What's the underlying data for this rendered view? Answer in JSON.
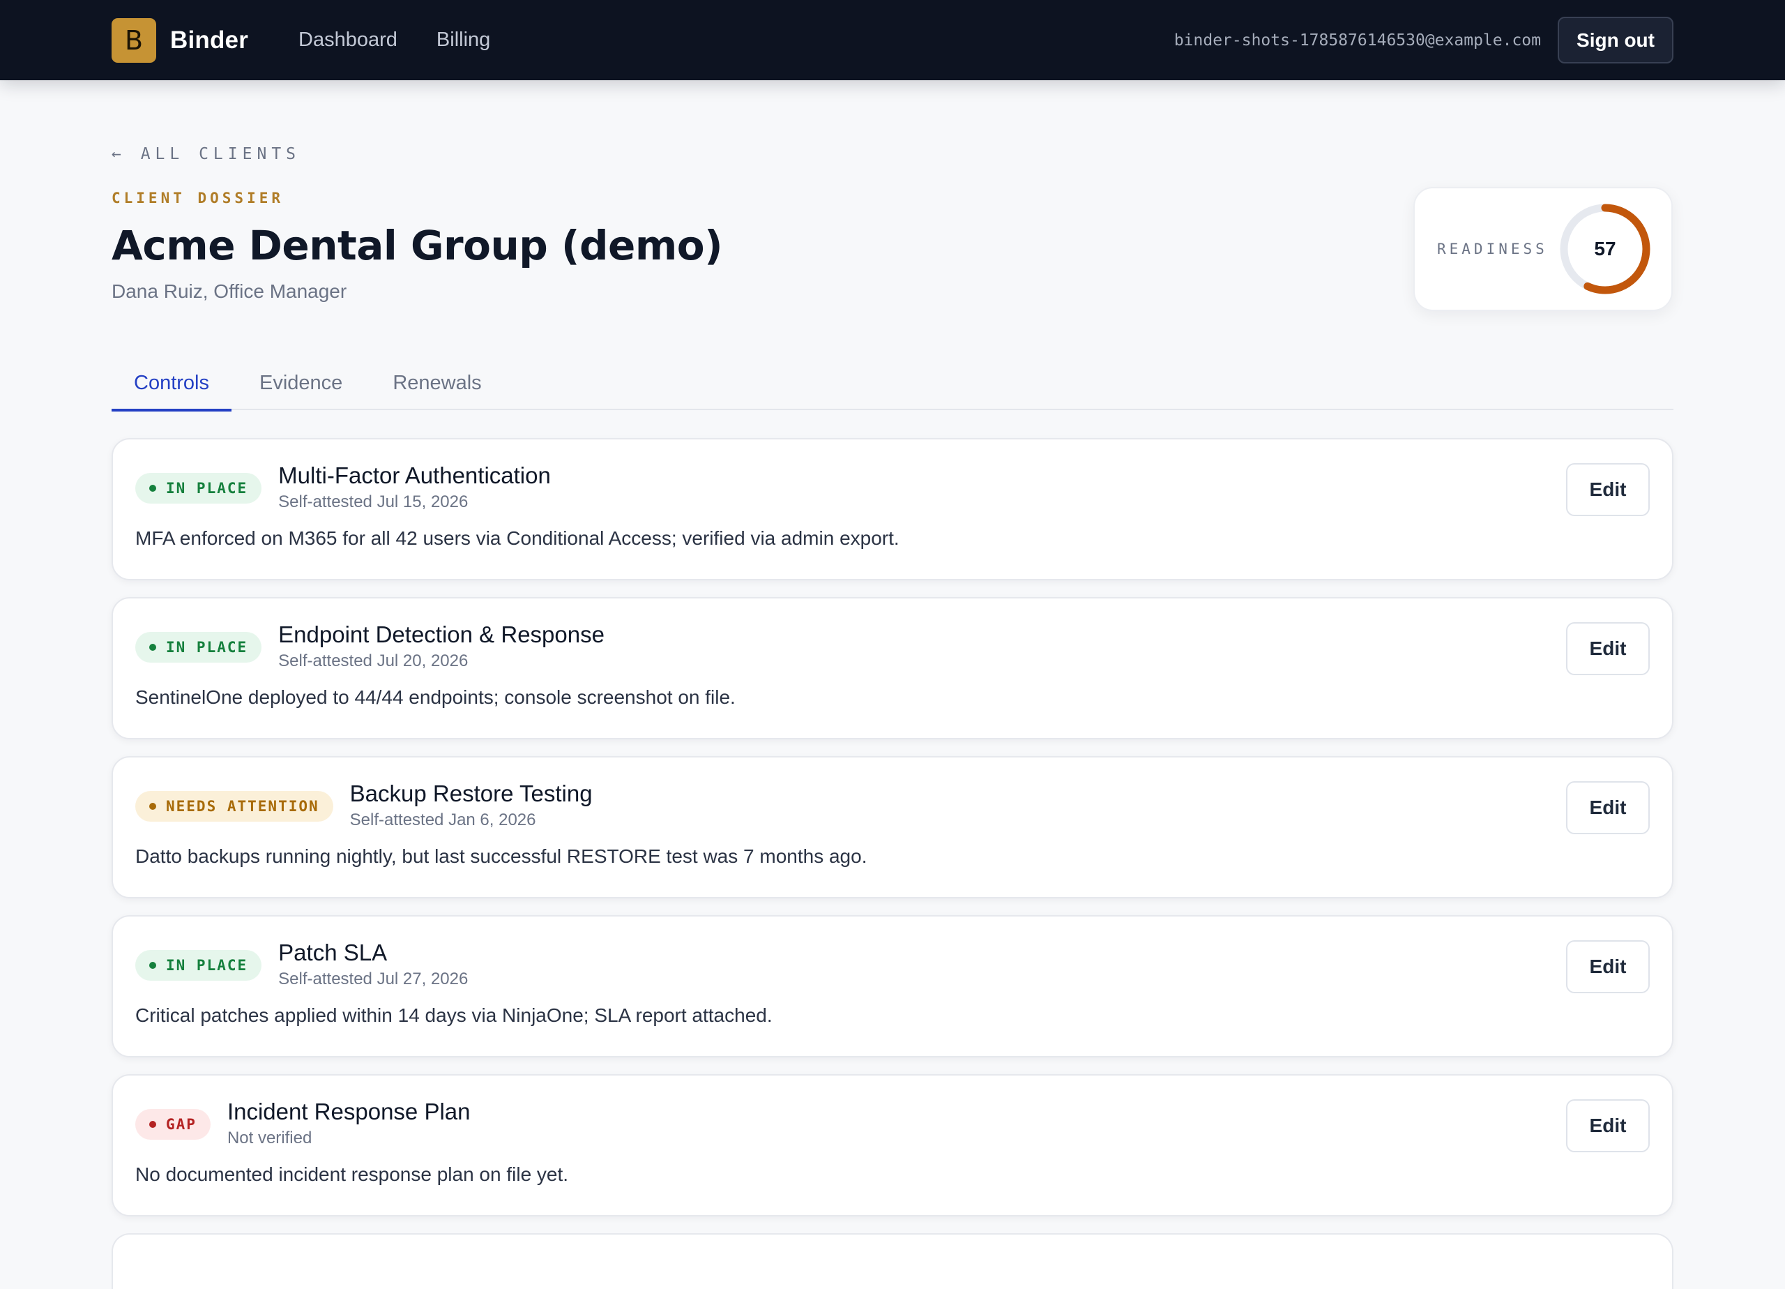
{
  "app": {
    "brand_initial": "B",
    "brand_name": "Binder",
    "nav": [
      "Dashboard",
      "Billing"
    ],
    "user_email": "binder-shots-1785876146530@example.com",
    "sign_out_label": "Sign out"
  },
  "header": {
    "back_label": "← ALL CLIENTS",
    "eyebrow": "CLIENT DOSSIER",
    "title": "Acme Dental Group (demo)",
    "subtitle": "Dana Ruiz, Office Manager",
    "readiness_label": "READINESS",
    "readiness_value": 57,
    "readiness_color": "#c2570c"
  },
  "tabs": [
    {
      "label": "Controls",
      "active": true
    },
    {
      "label": "Evidence",
      "active": false
    },
    {
      "label": "Renewals",
      "active": false
    }
  ],
  "controls": [
    {
      "status": "IN PLACE",
      "status_kind": "in-place",
      "title": "Multi-Factor Authentication",
      "attestation": "Self-attested Jul 15, 2026",
      "description": "MFA enforced on M365 for all 42 users via Conditional Access; verified via admin export.",
      "edit_label": "Edit"
    },
    {
      "status": "IN PLACE",
      "status_kind": "in-place",
      "title": "Endpoint Detection & Response",
      "attestation": "Self-attested Jul 20, 2026",
      "description": "SentinelOne deployed to 44/44 endpoints; console screenshot on file.",
      "edit_label": "Edit"
    },
    {
      "status": "NEEDS ATTENTION",
      "status_kind": "attention",
      "title": "Backup Restore Testing",
      "attestation": "Self-attested Jan 6, 2026",
      "description": "Datto backups running nightly, but last successful RESTORE test was 7 months ago.",
      "edit_label": "Edit"
    },
    {
      "status": "IN PLACE",
      "status_kind": "in-place",
      "title": "Patch SLA",
      "attestation": "Self-attested Jul 27, 2026",
      "description": "Critical patches applied within 14 days via NinjaOne; SLA report attached.",
      "edit_label": "Edit"
    },
    {
      "status": "GAP",
      "status_kind": "gap",
      "title": "Incident Response Plan",
      "attestation": "Not verified",
      "description": "No documented incident response plan on file yet.",
      "edit_label": "Edit"
    }
  ],
  "colors": {
    "topbar": "#0d1321",
    "accent": "#2440c4",
    "brand": "#c69334",
    "in_place": "#15803d",
    "needs_attention": "#a86b09",
    "gap": "#b42323"
  }
}
